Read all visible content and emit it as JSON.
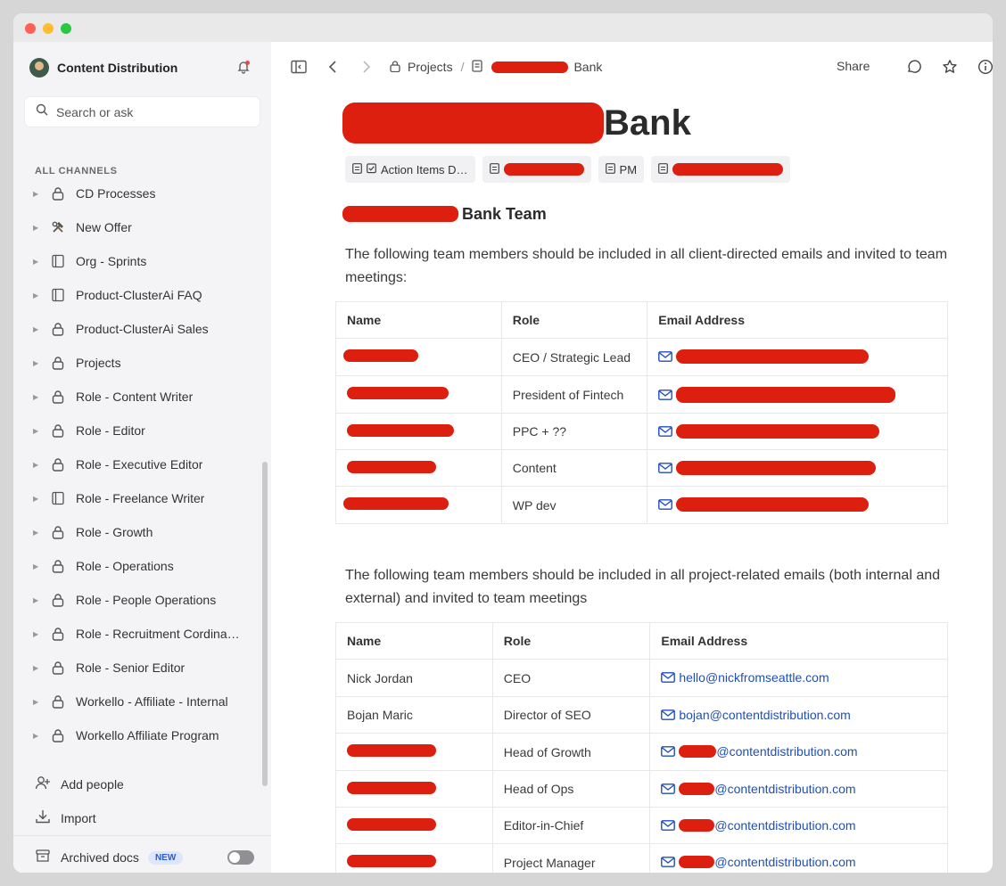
{
  "workspace": {
    "name": "Content Distribution"
  },
  "search": {
    "placeholder": "Search or ask"
  },
  "sidebar": {
    "section_label": "ALL CHANNELS",
    "channels": [
      {
        "label": "CD Processes",
        "icon": "lock-icon"
      },
      {
        "label": "New Offer",
        "icon": "tools-icon"
      },
      {
        "label": "Org - Sprints",
        "icon": "page-icon"
      },
      {
        "label": "Product-ClusterAi FAQ",
        "icon": "page-icon"
      },
      {
        "label": "Product-ClusterAi Sales",
        "icon": "lock-icon"
      },
      {
        "label": "Projects",
        "icon": "lock-icon"
      },
      {
        "label": "Role - Content Writer",
        "icon": "lock-icon"
      },
      {
        "label": "Role - Editor",
        "icon": "lock-icon"
      },
      {
        "label": "Role - Executive Editor",
        "icon": "lock-icon"
      },
      {
        "label": "Role - Freelance Writer",
        "icon": "page-icon"
      },
      {
        "label": "Role - Growth",
        "icon": "lock-icon"
      },
      {
        "label": "Role - Operations",
        "icon": "lock-icon"
      },
      {
        "label": "Role - People Operations",
        "icon": "lock-icon"
      },
      {
        "label": "Role - Recruitment Cordina…",
        "icon": "lock-icon"
      },
      {
        "label": "Role - Senior Editor",
        "icon": "lock-icon"
      },
      {
        "label": "Workello - Affiliate - Internal",
        "icon": "lock-icon"
      },
      {
        "label": "Workello Affiliate Program",
        "icon": "lock-icon"
      }
    ],
    "add_people": "Add people",
    "import": "Import",
    "archived_docs": "Archived docs",
    "new_badge": "NEW"
  },
  "topbar": {
    "breadcrumb_projects": "Projects",
    "breadcrumb_sep": "/",
    "breadcrumb_doc_suffix": "Bank",
    "share": "Share"
  },
  "doc": {
    "title_suffix": "Bank",
    "chips": [
      "Action Items D…",
      "PM"
    ],
    "team_heading_suffix": "Bank Team",
    "para1": "The following team members should be included in all client-directed emails and invited to team meetings:",
    "para2": "The following team members should be included in all project-related emails (both internal and external) and invited to team meetings",
    "table_headers": {
      "name": "Name",
      "role": "Role",
      "email": "Email Address"
    },
    "client_roles": [
      "CEO / Strategic Lead",
      "President of Fintech",
      "PPC + ??",
      "Content",
      "WP dev"
    ],
    "internal_team": [
      {
        "name": "Nick Jordan",
        "role": "CEO",
        "email": "hello@nickfromseattle.com"
      },
      {
        "name": "Bojan Maric",
        "role": "Director of SEO",
        "email": "bojan@contentdistribution.com"
      },
      {
        "name": "",
        "role": "Head of Growth",
        "email_domain": "@contentdistribution.com"
      },
      {
        "name": "",
        "role": "Head of Ops",
        "email_domain": "@contentdistribution.com"
      },
      {
        "name": "",
        "role": "Editor-in-Chief",
        "email_domain": "@contentdistribution.com"
      },
      {
        "name": "",
        "role": "Project Manager",
        "email_domain": "@contentdistribution.com"
      }
    ]
  },
  "colors": {
    "redaction": "#dd1f10",
    "link": "#1f4fb8",
    "sidebar_bg": "#f4f4f6"
  }
}
